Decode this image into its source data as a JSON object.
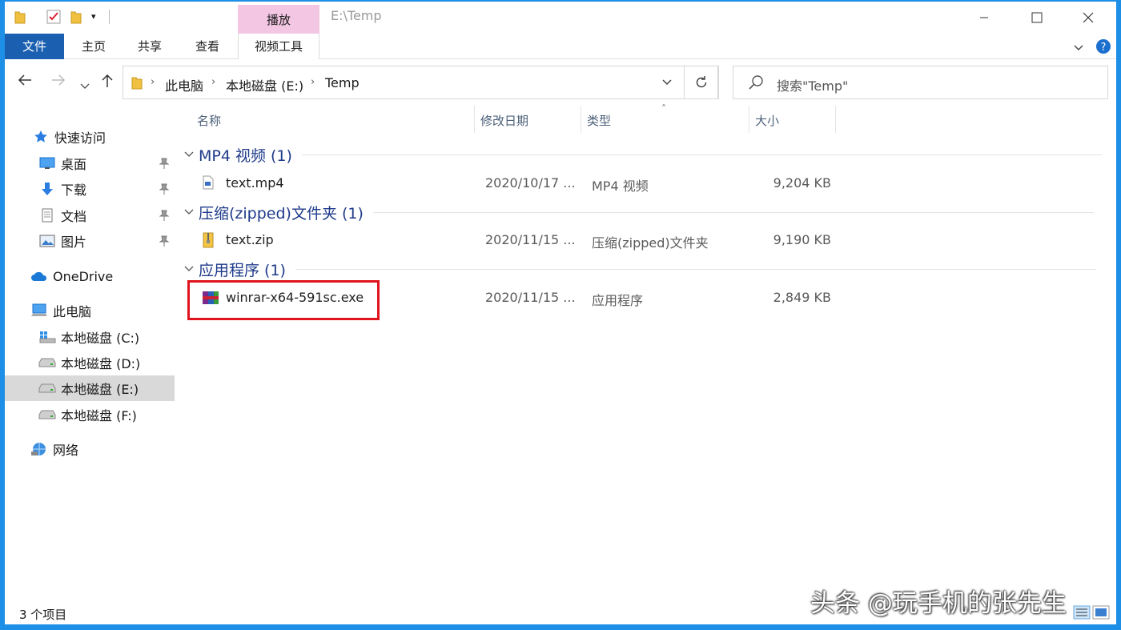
{
  "window": {
    "title": "E:\\Temp",
    "context_tab_label": "播放"
  },
  "ribbon": {
    "tabs": [
      {
        "label": "文件"
      },
      {
        "label": "主页"
      },
      {
        "label": "共享"
      },
      {
        "label": "查看"
      },
      {
        "label": "视频工具"
      }
    ]
  },
  "address": {
    "breadcrumbs": [
      {
        "label": "此电脑"
      },
      {
        "label": "本地磁盘 (E:)"
      },
      {
        "label": "Temp"
      }
    ]
  },
  "search": {
    "placeholder": "搜索\"Temp\""
  },
  "sidebar": {
    "items": [
      {
        "label": "快速访问",
        "icon": "star-icon"
      },
      {
        "label": "桌面",
        "icon": "desktop-icon",
        "pinned": true
      },
      {
        "label": "下载",
        "icon": "download-icon",
        "pinned": true
      },
      {
        "label": "文档",
        "icon": "document-icon",
        "pinned": true
      },
      {
        "label": "图片",
        "icon": "pictures-icon",
        "pinned": true
      },
      {
        "label": "OneDrive",
        "icon": "cloud-icon"
      },
      {
        "label": "此电脑",
        "icon": "computer-icon"
      },
      {
        "label": "本地磁盘 (C:)",
        "icon": "system-drive-icon"
      },
      {
        "label": "本地磁盘 (D:)",
        "icon": "drive-icon"
      },
      {
        "label": "本地磁盘 (E:)",
        "icon": "drive-icon",
        "selected": true
      },
      {
        "label": "本地磁盘 (F:)",
        "icon": "drive-icon"
      },
      {
        "label": "网络",
        "icon": "network-icon"
      }
    ]
  },
  "columns": {
    "name": "名称",
    "date": "修改日期",
    "type": "类型",
    "size": "大小"
  },
  "groups": [
    {
      "name": "MP4 视频 (1)",
      "files": [
        {
          "name": "text.mp4",
          "date": "2020/10/17 ...",
          "type": "MP4 视频",
          "size": "9,204 KB",
          "icon": "video-file-icon"
        }
      ]
    },
    {
      "name": "压缩(zipped)文件夹 (1)",
      "files": [
        {
          "name": "text.zip",
          "date": "2020/11/15 ...",
          "type": "压缩(zipped)文件夹",
          "size": "9,190 KB",
          "icon": "zip-folder-icon"
        }
      ]
    },
    {
      "name": "应用程序 (1)",
      "files": [
        {
          "name": "winrar-x64-591sc.exe",
          "date": "2020/11/15 ...",
          "type": "应用程序",
          "size": "2,849 KB",
          "icon": "winrar-icon"
        }
      ]
    }
  ],
  "status": {
    "item_count": "3 个项目"
  },
  "watermark": "头条 @玩手机的张先生",
  "colors": {
    "accent": "#1a5fb0",
    "context_tab": "#f3c6e3",
    "highlight_box": "#e0141e",
    "group_title": "#1e3a8a"
  }
}
